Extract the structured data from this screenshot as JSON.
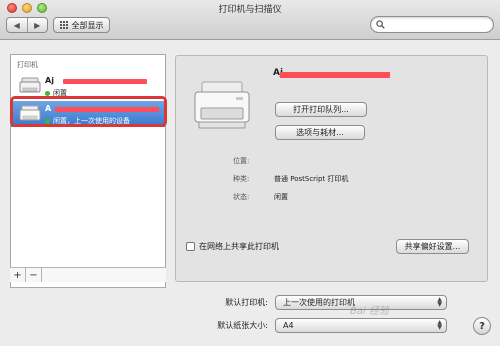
{
  "window": {
    "title": "打印机与扫描仪"
  },
  "toolbar": {
    "back": "◀",
    "forward": "▶",
    "show_all": "全部显示",
    "search_placeholder": ""
  },
  "printer_list": {
    "header": "打印机",
    "items": [
      {
        "name": "Aj",
        "status": "闲置"
      },
      {
        "name": "A",
        "status": "闲置，上一次使用的设备"
      }
    ],
    "add_label": "+",
    "remove_label": "−"
  },
  "detail": {
    "name": "Aj",
    "open_queue": "打开打印队列...",
    "options_supplies": "选项与耗材...",
    "location_label": "位置:",
    "location_value": "",
    "kind_label": "种类:",
    "kind_value": "普通 PostScript 打印机",
    "status_label": "状态:",
    "status_value": "闲置",
    "share_label": "在网络上共享此打印机",
    "share_prefs": "共享偏好设置..."
  },
  "defaults": {
    "default_printer_label": "默认打印机:",
    "default_printer_value": "上一次使用的打印机",
    "paper_size_label": "默认纸张大小:",
    "paper_size_value": "A4"
  },
  "help": "?",
  "watermark": "Bai 经验",
  "colors": {
    "selection": "#3a78cf",
    "highlight_border": "#d93838",
    "redaction": "#ff4d5a",
    "status_green": "#41b636"
  },
  "icons": {
    "back": "chevron-left-icon",
    "forward": "chevron-right-icon",
    "grid": "grid-icon",
    "search": "search-icon",
    "printer": "printer-icon"
  }
}
